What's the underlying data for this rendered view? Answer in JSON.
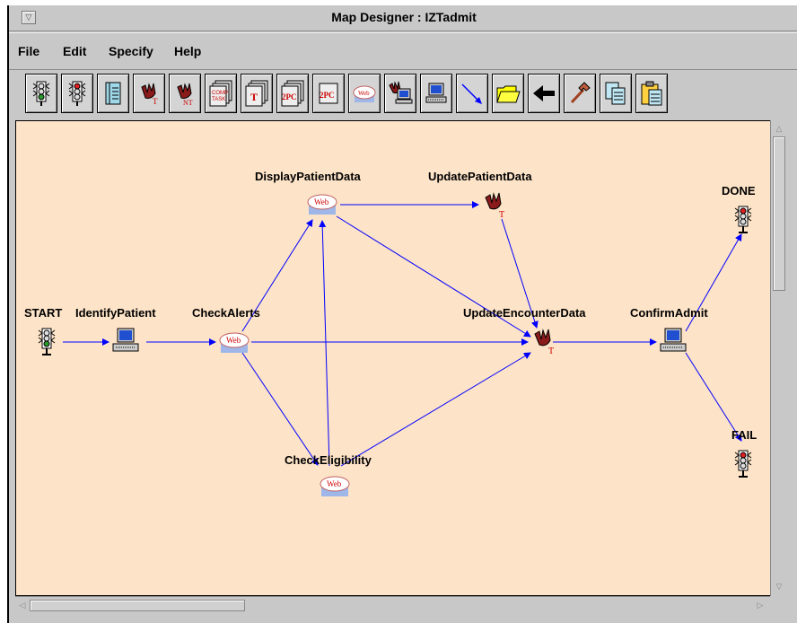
{
  "window": {
    "title": "Map Designer : IZTadmit"
  },
  "menu": [
    "File",
    "Edit",
    "Specify",
    "Help"
  ],
  "toolbar": {
    "buttons": [
      {
        "icon": "start-light-icon"
      },
      {
        "icon": "stop-light-icon"
      },
      {
        "icon": "notebook-icon"
      },
      {
        "icon": "transaction-T-icon",
        "text": "T"
      },
      {
        "icon": "transaction-NT-icon",
        "text": "NT"
      },
      {
        "icon": "comp-task-icon",
        "text": "COMP TASK"
      },
      {
        "icon": "T-stack-icon",
        "text": "T"
      },
      {
        "icon": "2pc-stack-icon",
        "text": "2PC"
      },
      {
        "icon": "2pc-icon",
        "text": "2PC"
      },
      {
        "icon": "web-icon",
        "text": "Web"
      },
      {
        "icon": "hand-computer-icon"
      },
      {
        "icon": "computer-icon"
      },
      {
        "icon": "arrow-connector-icon"
      },
      {
        "icon": "open-folder-icon"
      },
      {
        "icon": "back-arrow-icon"
      },
      {
        "icon": "hammer-icon"
      },
      {
        "icon": "copy-pages-icon"
      },
      {
        "icon": "clipboard-icon"
      }
    ]
  },
  "nodes": {
    "start": {
      "label": "START",
      "type": "start-light"
    },
    "identify_patient": {
      "label": "IdentifyPatient",
      "type": "computer"
    },
    "check_alerts": {
      "label": "CheckAlerts",
      "type": "web"
    },
    "display_patient_data": {
      "label": "DisplayPatientData",
      "type": "web"
    },
    "update_patient_data": {
      "label": "UpdatePatientData",
      "type": "transaction"
    },
    "update_encounter_data": {
      "label": "UpdateEncounterData",
      "type": "transaction"
    },
    "confirm_admit": {
      "label": "ConfirmAdmit",
      "type": "computer"
    },
    "done": {
      "label": "DONE",
      "type": "stop-light"
    },
    "fail": {
      "label": "FAIL",
      "type": "stop-light"
    },
    "check_eligibility": {
      "label": "CheckEligibility",
      "type": "web"
    }
  },
  "edges": [
    [
      "start",
      "identify_patient"
    ],
    [
      "identify_patient",
      "check_alerts"
    ],
    [
      "check_alerts",
      "display_patient_data"
    ],
    [
      "check_alerts",
      "update_encounter_data"
    ],
    [
      "check_alerts",
      "check_eligibility"
    ],
    [
      "display_patient_data",
      "update_patient_data"
    ],
    [
      "display_patient_data",
      "update_encounter_data"
    ],
    [
      "check_eligibility",
      "display_patient_data"
    ],
    [
      "update_patient_data",
      "update_encounter_data"
    ],
    [
      "check_eligibility",
      "update_encounter_data"
    ],
    [
      "update_encounter_data",
      "confirm_admit"
    ],
    [
      "confirm_admit",
      "done"
    ],
    [
      "confirm_admit",
      "fail"
    ]
  ],
  "colors": {
    "canvas": "#fde3c7",
    "edge": "#0000ff",
    "chrome": "#c8c8c8"
  },
  "web_icon_text": "Web",
  "transaction_icon_text": "T"
}
